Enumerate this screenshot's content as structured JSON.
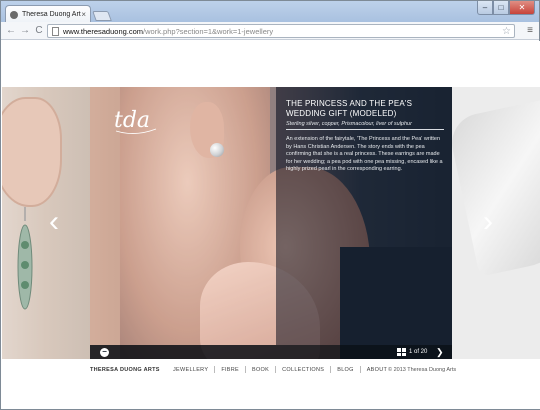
{
  "browser": {
    "tab_title": "Theresa Duong Arts",
    "tab_close": "×",
    "url_host": "www.theresaduong.com",
    "url_path": "/work.php?section=1&work=1-jewellery",
    "back_icon": "←",
    "forward_icon": "→",
    "reload_icon": "C",
    "star_icon": "☆",
    "menu_icon": "≡",
    "minimize": "–",
    "maximize": "□",
    "close": "✕"
  },
  "slide": {
    "logo": "tda",
    "title": "THE PRINCESS AND THE PEA'S WEDDING GIFT (MODELED)",
    "materials": "Sterling silver, copper, Prismacolour, liver of sulphur",
    "description": "An extension of the fairytale, 'The Princess and the Pea' written by Hans Christian Andersen. The story ends with the pea confirming that she is a real princess. These earrings are made for her wedding; a pea pod with one pea missing, encased like a highly prized pearl in the corresponding earring.",
    "collapse_icon": "−",
    "pager": "1 of 20",
    "next_icon": "❯"
  },
  "arrows": {
    "prev": "‹",
    "next": "›"
  },
  "footer": {
    "brand": "THERESA DUONG ARTS",
    "nav": [
      "JEWELLERY",
      "FIBRE",
      "BOOK",
      "COLLECTIONS",
      "BLOG",
      "ABOUT"
    ],
    "copyright": "© 2013 Theresa Duong Arts"
  }
}
